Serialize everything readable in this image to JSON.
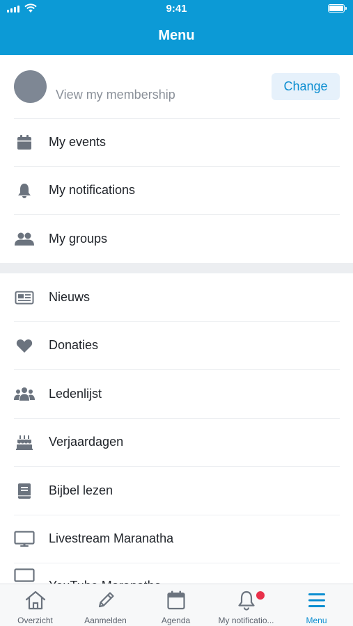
{
  "status_bar": {
    "time": "9:41"
  },
  "header": {
    "title": "Menu"
  },
  "profile": {
    "membership_label": "View my membership",
    "change_label": "Change"
  },
  "menu_personal": [
    {
      "label": "My events",
      "icon": "calendar-icon"
    },
    {
      "label": "My notifications",
      "icon": "bell-icon"
    },
    {
      "label": "My groups",
      "icon": "users-icon"
    }
  ],
  "menu_church": [
    {
      "label": "Nieuws",
      "icon": "newspaper-icon"
    },
    {
      "label": "Donaties",
      "icon": "heart-icon"
    },
    {
      "label": "Ledenlijst",
      "icon": "group-icon"
    },
    {
      "label": "Verjaardagen",
      "icon": "birthday-cake-icon"
    },
    {
      "label": "Bijbel lezen",
      "icon": "book-icon"
    },
    {
      "label": "Livestream Maranatha",
      "icon": "monitor-icon"
    },
    {
      "label": "YouTube Maranatha",
      "icon": "monitor-icon"
    }
  ],
  "tab_bar": {
    "tabs": [
      {
        "label": "Overzicht",
        "icon": "home-icon"
      },
      {
        "label": "Aanmelden",
        "icon": "pencil-icon"
      },
      {
        "label": "Agenda",
        "icon": "calendar-icon"
      },
      {
        "label": "My notificatio...",
        "icon": "bell-icon",
        "has_badge": true
      },
      {
        "label": "Menu",
        "icon": "menu-icon",
        "active": true
      }
    ]
  },
  "colors": {
    "brand": "#0c9ad6",
    "icon": "#6b737e",
    "badge": "#e8304a",
    "active_tab": "#0c8ed1"
  }
}
